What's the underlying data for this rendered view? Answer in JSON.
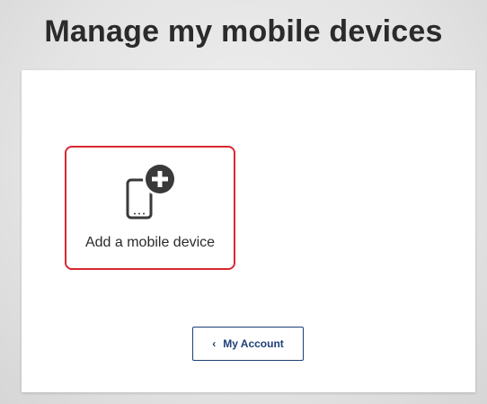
{
  "page": {
    "title": "Manage my mobile devices"
  },
  "add_device": {
    "label": "Add a mobile device",
    "icon": "add-mobile-device-icon",
    "border_color": "#d8282f"
  },
  "account_button": {
    "label": "My Account",
    "icon": "chevron-left-icon",
    "chevron_glyph": "‹",
    "color": "#1f3f77"
  }
}
